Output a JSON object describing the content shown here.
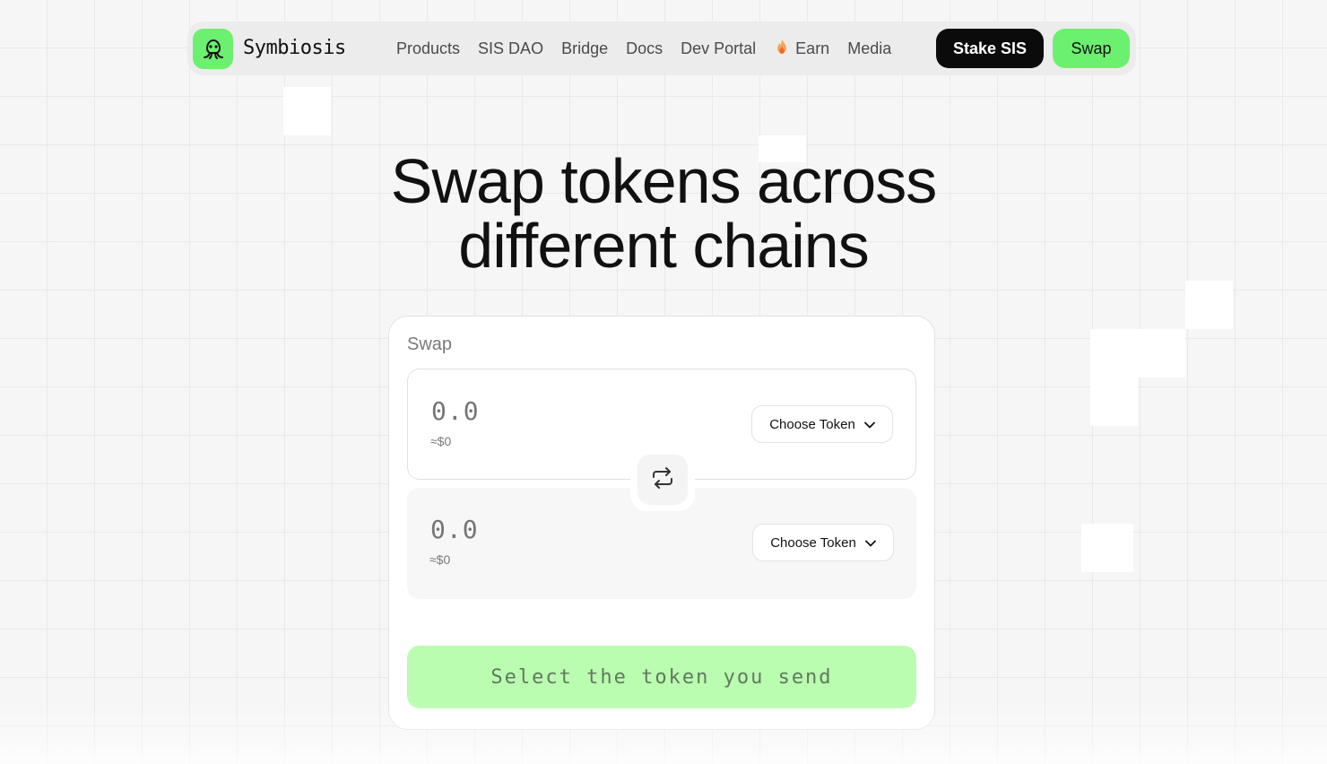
{
  "brand": {
    "name": "Symbiosis",
    "accent": "#6cf06f"
  },
  "nav": {
    "links": [
      {
        "label": "Products"
      },
      {
        "label": "SIS DAO"
      },
      {
        "label": "Bridge"
      },
      {
        "label": "Docs"
      },
      {
        "label": "Dev Portal"
      },
      {
        "label": "Earn",
        "icon": "fire-icon"
      },
      {
        "label": "Media"
      }
    ],
    "stake_label": "Stake SIS",
    "swap_label": "Swap"
  },
  "hero": {
    "line1": "Swap tokens across",
    "line2": "different chains"
  },
  "swap": {
    "title": "Swap",
    "from": {
      "amount_placeholder": "0.0",
      "usd": "≈$0",
      "token_label": "Choose Token"
    },
    "to": {
      "amount_placeholder": "0.0",
      "usd": "≈$0",
      "token_label": "Choose Token"
    },
    "switch_icon": "swap-arrows-icon",
    "cta_label": "Select the token you send",
    "cta_color": "#bafcb0"
  }
}
